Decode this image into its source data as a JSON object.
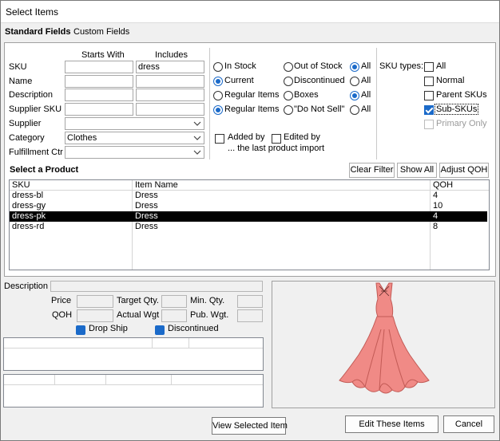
{
  "window": {
    "title": "Select Items"
  },
  "tabs": {
    "standard": "Standard Fields",
    "custom": "Custom Fields"
  },
  "fields": {
    "starts_with_header": "Starts With",
    "includes_header": "Includes",
    "sku_label": "SKU",
    "sku_includes_value": "dress",
    "name_label": "Name",
    "description_label": "Description",
    "supplier_sku_label": "Supplier SKU",
    "supplier_label": "Supplier",
    "category_label": "Category",
    "category_value": "Clothes",
    "fulfillment_label": "Fulfillment Ctr"
  },
  "stock_filters": {
    "in_stock": "In Stock",
    "out_of_stock": "Out of Stock",
    "all_1": "All",
    "current": "Current",
    "discontinued": "Discontinued",
    "all_2": "All",
    "regular_items": "Regular Items",
    "boxes": "Boxes",
    "all_3": "All",
    "regular_items_2": "Regular Items",
    "do_not_sell": "\"Do Not Sell\"",
    "all_4": "All",
    "added_by": "Added by",
    "edited_by": "Edited by",
    "last_import": "... the last product import"
  },
  "sku_types": {
    "label": "SKU types:",
    "all": "All",
    "normal": "Normal",
    "parent": "Parent SKUs",
    "sub": "Sub-SKUs",
    "primary": "Primary Only"
  },
  "product_list": {
    "heading": "Select a Product",
    "clear_filter": "Clear Filter",
    "show_all": "Show All",
    "adjust_qoh": "Adjust QOH",
    "columns": [
      "SKU",
      "Item Name",
      "QOH"
    ],
    "rows": [
      [
        "dress-bl",
        "Dress",
        "4"
      ],
      [
        "dress-gy",
        "Dress",
        "10"
      ],
      [
        "dress-pk",
        "Dress",
        "4"
      ],
      [
        "dress-rd",
        "Dress",
        "8"
      ]
    ],
    "selected_row": 2
  },
  "details": {
    "description_label": "Description",
    "price_label": "Price",
    "target_qty_label": "Target Qty.",
    "min_qty_label": "Min. Qty.",
    "qoh_label": "QOH",
    "actual_wgt_label": "Actual Wgt",
    "pub_wgt_label": "Pub. Wgt.",
    "drop_ship_label": "Drop Ship",
    "discontinued_label": "Discontinued"
  },
  "footer": {
    "view_selected": "View Selected Item",
    "edit_these": "Edit These Items",
    "cancel": "Cancel"
  },
  "colors": {
    "accent": "#1b6ac9",
    "dress_fill": "#f08a86",
    "dress_outline": "#c25a55",
    "selected_row": "#000000"
  }
}
